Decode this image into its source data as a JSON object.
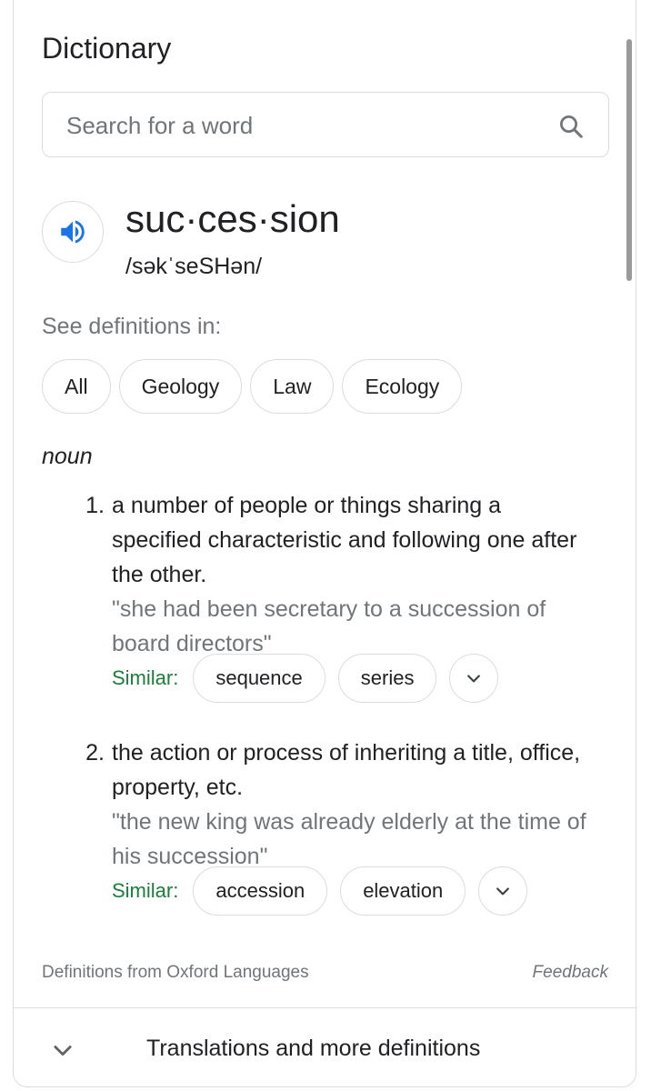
{
  "card": {
    "title": "Dictionary"
  },
  "search": {
    "placeholder": "Search for a word",
    "value": ""
  },
  "entry": {
    "word": "suc·ces·sion",
    "phonetic": "/səkˈseSHən/"
  },
  "see_definitions": {
    "label": "See definitions in:",
    "chips": [
      "All",
      "Geology",
      "Law",
      "Ecology"
    ]
  },
  "part_of_speech": "noun",
  "definitions": [
    {
      "number": "1.",
      "text": "a number of people or things sharing a specified characteristic and following one after the other.",
      "example": "\"she had been secretary to a succession of board directors\"",
      "similar_label": "Similar:",
      "similar": [
        "sequence",
        "series"
      ]
    },
    {
      "number": "2.",
      "text": "the action or process of inheriting a title, office, property, etc.",
      "example": "\"the new king was already elderly at the time of his succession\"",
      "similar_label": "Similar:",
      "similar": [
        "accession",
        "elevation"
      ]
    }
  ],
  "footer": {
    "source": "Definitions from Oxford Languages",
    "feedback": "Feedback",
    "more_label": "Translations and more definitions"
  },
  "icons": {
    "search": "search-icon",
    "speaker": "speaker-icon",
    "expand": "chevron-down-icon"
  },
  "colors": {
    "accent_blue": "#1a73e8",
    "similar_green": "#188038",
    "secondary_text": "#70757a",
    "border": "#dadce0"
  }
}
